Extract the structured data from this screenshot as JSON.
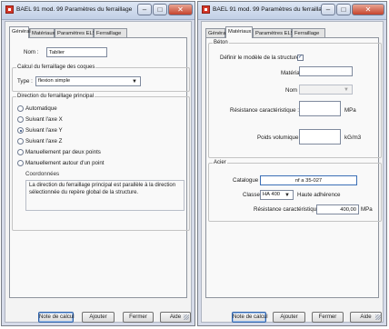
{
  "windows": {
    "left": {
      "title": "BAEL 91 mod. 99 Paramètres du ferraillage",
      "tabs": [
        "Général",
        "Matériaux",
        "Paramètres ELS",
        "Ferraillage"
      ],
      "active_tab": "Général",
      "name_label": "Nom :",
      "name_value": "Tablier",
      "calc_group": "Calcul du ferraillage des coques",
      "type_label": "Type :",
      "type_value": "flexion simple",
      "direction_group": "Direction du ferraillage principal",
      "radios": [
        {
          "label": "Automatique",
          "checked": false
        },
        {
          "label": "Suivant l'axe X",
          "checked": false
        },
        {
          "label": "Suivant l'axe Y",
          "checked": true
        },
        {
          "label": "Suivant l'axe Z",
          "checked": false
        },
        {
          "label": "Manuellement par deux points",
          "checked": false
        },
        {
          "label": "Manuellement autour d'un point",
          "checked": false
        }
      ],
      "coord_label": "Coordonnées",
      "description": "La direction du ferraillage principal est parallèle à la direction sélectionnée du repère global de la structure.",
      "buttons": [
        "Note de calcul",
        "Ajouter",
        "Fermer",
        "Aide"
      ]
    },
    "right": {
      "title": "BAEL 91 mod. 99 Paramètres du ferraillage",
      "tabs": [
        "Général",
        "Matériaux",
        "Paramètres ELS",
        "Ferraillage"
      ],
      "active_tab": "Matériaux",
      "beton_group": "Béton",
      "define_label": "Définir le modèle de la structure",
      "define_checked": true,
      "materiaux_label": "Matériaux :",
      "nom_label": "Nom :",
      "resistance_label": "Résistance caractéristique :",
      "resistance_unit": "MPa",
      "poids_label": "Poids volumique :",
      "poids_unit": "kG/m3",
      "acier_group": "Acier",
      "catalogue_label": "Catalogue :",
      "catalogue_value": "nf a 35-027",
      "classe_label": "Classe :",
      "classe_value": "HA 400",
      "haute_adherence": "Haute adhérence",
      "resistance_acier_label": "Résistance caractéristique :",
      "resistance_acier_value": "400,00",
      "resistance_acier_unit": "MPa",
      "buttons": [
        "Note de calcul",
        "Ajouter",
        "Fermer",
        "Aide"
      ]
    }
  }
}
